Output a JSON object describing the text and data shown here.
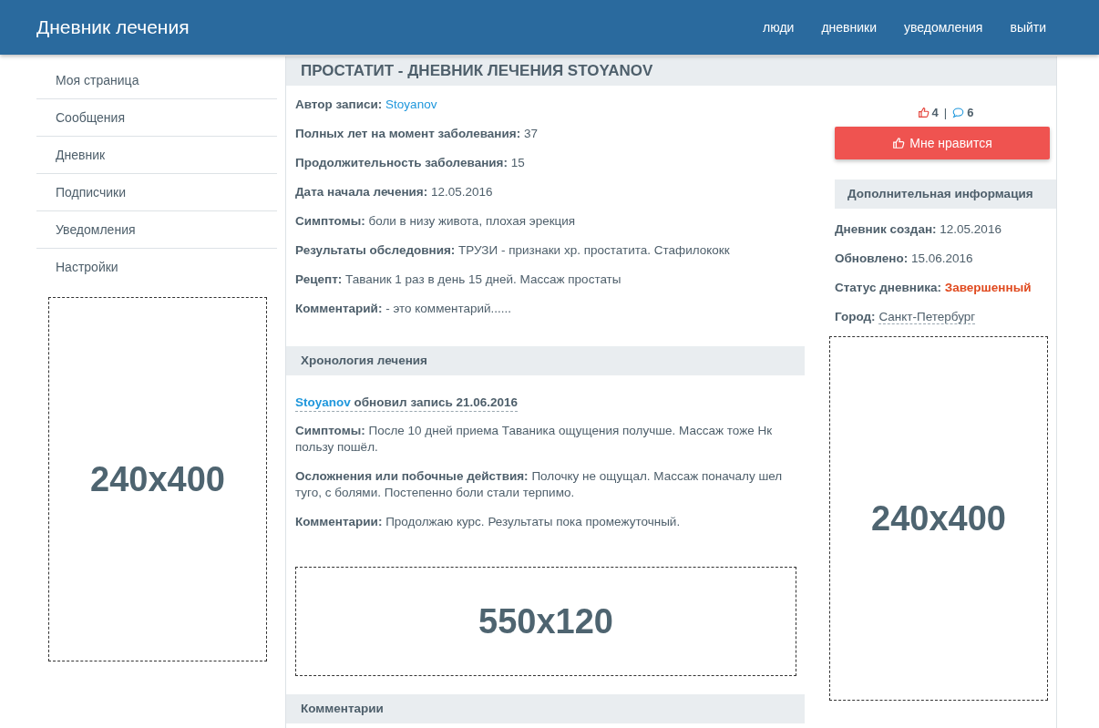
{
  "header": {
    "title": "Дневник лечения",
    "nav": [
      {
        "label": "люди"
      },
      {
        "label": "дневники"
      },
      {
        "label": "уведомления"
      },
      {
        "label": "выйти"
      }
    ]
  },
  "sidebar": {
    "items": [
      {
        "label": "Моя страница"
      },
      {
        "label": "Сообщения"
      },
      {
        "label": "Дневник"
      },
      {
        "label": "Подписчики"
      },
      {
        "label": "Уведомления"
      },
      {
        "label": "Настройки"
      }
    ],
    "ad": {
      "label": "240x400"
    }
  },
  "page_title": "ПРОСТАТИТ - ДНЕВНИК ЛЕЧЕНИЯ STOYANOV",
  "fields": [
    {
      "label": "Автор записи:",
      "value": "Stoyanov",
      "kind": "link"
    },
    {
      "label": "Полных лет на момент заболевания:",
      "value": "37",
      "kind": "text"
    },
    {
      "label": "Продолжительность заболевания:",
      "value": "15",
      "kind": "text"
    },
    {
      "label": "Дата начала лечения:",
      "value": "12.05.2016",
      "kind": "text"
    },
    {
      "label": "Симптомы:",
      "value": "боли в низу живота, плохая эрекция",
      "kind": "text"
    },
    {
      "label": "Результаты обследовния:",
      "value": "ТРУЗИ - признаки хр. простатита. Стафилококк",
      "kind": "text"
    },
    {
      "label": "Рецепт:",
      "value": "Таваник 1 раз в день 15 дней. Массаж простаты",
      "kind": "text"
    },
    {
      "label": "Комментарий:",
      "value": "- это комментарий......",
      "kind": "text"
    }
  ],
  "timeline": {
    "title": "Хронология лечения",
    "entries": [
      {
        "author": "Stoyanov",
        "action": "обновил запись 21.06.2016",
        "fields": [
          {
            "label": "Симптомы:",
            "value": "После 10 дней приема Таваника ощущения получше. Массаж тоже Нк пользу пошёл."
          },
          {
            "label": "Осложнения или побочные действия:",
            "value": "Полочку не ощущал. Массаж поначалу шел туго, с болями. Постепенно боли стали терпимо."
          },
          {
            "label": "Комментарии:",
            "value": "Продолжаю курс. Результаты пока промежуточный."
          }
        ]
      }
    ]
  },
  "content_ad": {
    "label": "550x120"
  },
  "comments": {
    "title": "Комментарии"
  },
  "stats": {
    "likes": "4",
    "separator": "|",
    "comments": "6"
  },
  "like_button": {
    "label": "Мне нравится"
  },
  "info": {
    "title": "Дополнительная информация",
    "fields": [
      {
        "label": "Дневник создан:",
        "value": "12.05.2016",
        "kind": "text"
      },
      {
        "label": "Обновлено:",
        "value": "15.06.2016",
        "kind": "text"
      },
      {
        "label": "Статус дневника:",
        "value": "Завершенный",
        "kind": "status"
      },
      {
        "label": "Город:",
        "value": "Санкт-Петербург",
        "kind": "place"
      }
    ]
  },
  "right_ad": {
    "label": "240x400"
  }
}
